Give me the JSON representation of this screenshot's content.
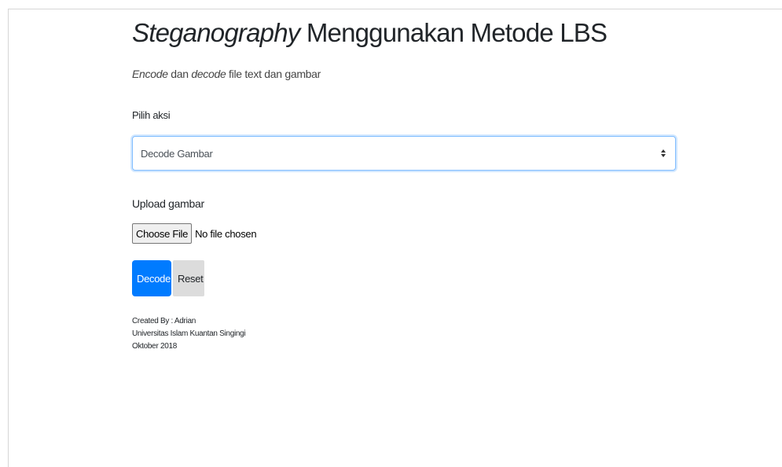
{
  "title": {
    "italic": "Steganography",
    "rest": " Menggunakan Metode LBS"
  },
  "subtitle": {
    "encode": "Encode",
    "dan1": " dan ",
    "decode": "decode",
    "rest": " file text dan gambar"
  },
  "form": {
    "action_label": "Pilih aksi",
    "action_selected": "Decode Gambar",
    "upload_label": "Upload gambar",
    "choose_file_label": "Choose File",
    "file_status": "No file chosen",
    "decode_label": "Decode",
    "reset_label": "Reset"
  },
  "footer": {
    "line1": "Created By : Adrian",
    "line2": "Universitas Islam Kuantan Singingi",
    "line3": "Oktober 2018"
  },
  "colors": {
    "primary": "#007bff",
    "focus_border": "#80bdff",
    "reset_bg": "#dcdcdc"
  },
  "icons": {
    "select_arrows": "up-down-arrows-icon"
  }
}
